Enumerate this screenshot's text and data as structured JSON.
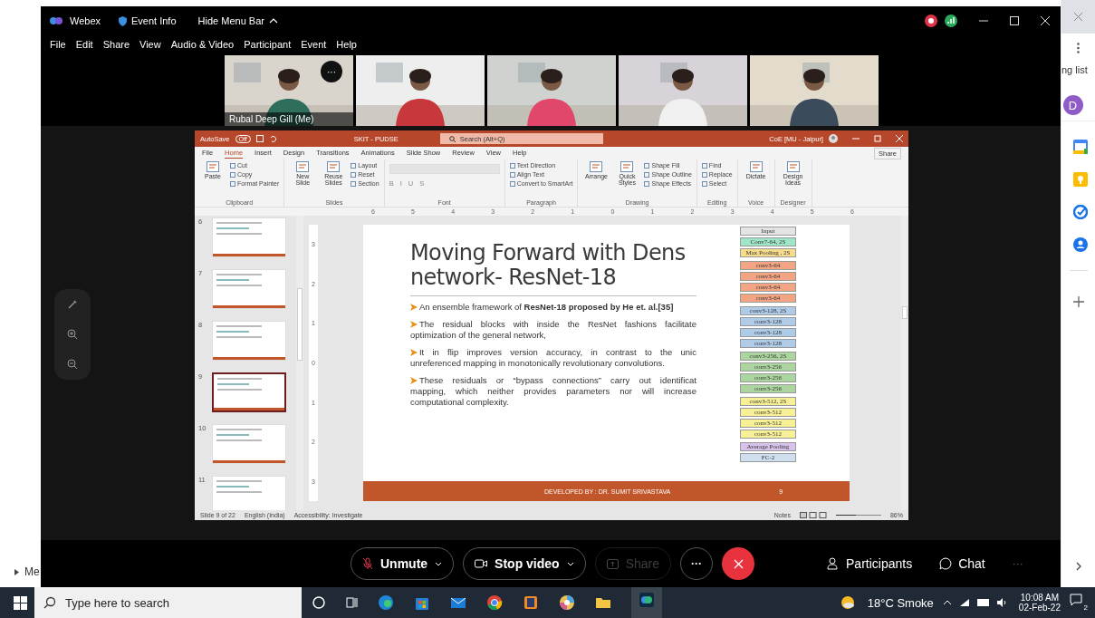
{
  "left_strip": {
    "item": "Me"
  },
  "webex": {
    "title_bar": {
      "app": "Webex",
      "event_info": "Event Info",
      "hide_menu": "Hide Menu Bar"
    },
    "menu": [
      "File",
      "Edit",
      "Share",
      "View",
      "Audio & Video",
      "Participant",
      "Event",
      "Help"
    ],
    "video_tiles": [
      {
        "kind": "picture",
        "label": "Rubal Deep Gill  (Me)",
        "more": "···"
      },
      {
        "kind": "picture"
      },
      {
        "kind": "picture"
      },
      {
        "kind": "picture"
      },
      {
        "kind": "picture"
      }
    ],
    "controls": [
      {
        "kind": "mute",
        "label": "Unmute",
        "disabled": false
      },
      {
        "kind": "video",
        "label": "Stop video",
        "disabled": false
      },
      {
        "kind": "share",
        "label": "Share",
        "disabled": true
      },
      {
        "kind": "more",
        "label": "···",
        "disabled": false
      },
      {
        "kind": "end",
        "disabled": false
      }
    ],
    "side_buttons": [
      {
        "kind": "participants",
        "label": "Participants"
      },
      {
        "kind": "chat",
        "label": "Chat"
      }
    ],
    "overflow": "···"
  },
  "powerpoint": {
    "title_bar": {
      "autosave": "AutoSave",
      "toggle": "Off",
      "file": "SKIT - PUDSE",
      "search": "Search (Alt+Q)",
      "account": "CoE [MU - Jaipur]"
    },
    "tabs": [
      {
        "label": "File",
        "selected": false
      },
      {
        "label": "Home",
        "selected": true
      },
      {
        "label": "Insert",
        "selected": false
      },
      {
        "label": "Design",
        "selected": false
      },
      {
        "label": "Transitions",
        "selected": false
      },
      {
        "label": "Animations",
        "selected": false
      },
      {
        "label": "Slide Show",
        "selected": false
      },
      {
        "label": "Review",
        "selected": false
      },
      {
        "label": "View",
        "selected": false
      },
      {
        "label": "Help",
        "selected": false
      }
    ],
    "share": "Share",
    "ribbon_groups": [
      {
        "name": "Clipboard",
        "items": [
          {
            "label": "Paste",
            "kind": "large"
          },
          {
            "label": "Cut",
            "kind": "small"
          },
          {
            "label": "Copy",
            "kind": "small"
          },
          {
            "label": "Format Painter",
            "kind": "small"
          }
        ]
      },
      {
        "name": "Slides",
        "items": [
          {
            "label": "New Slide",
            "kind": "large"
          },
          {
            "label": "Reuse Slides",
            "kind": "large"
          },
          {
            "label": "Layout",
            "kind": "small"
          },
          {
            "label": "Reset",
            "kind": "small"
          },
          {
            "label": "Section",
            "kind": "small"
          }
        ]
      },
      {
        "name": "Font",
        "items": [
          {
            "label": "B",
            "kind": "glyph"
          },
          {
            "label": "I",
            "kind": "glyph"
          },
          {
            "label": "U",
            "kind": "glyph"
          },
          {
            "label": "S",
            "kind": "glyph"
          }
        ]
      },
      {
        "name": "Paragraph",
        "items": [
          {
            "label": "Text Direction",
            "kind": "small"
          },
          {
            "label": "Align Text",
            "kind": "small"
          },
          {
            "label": "Convert to SmartArt",
            "kind": "small"
          }
        ]
      },
      {
        "name": "Drawing",
        "items": [
          {
            "label": "Arrange",
            "kind": "large"
          },
          {
            "label": "Quick Styles",
            "kind": "large"
          },
          {
            "label": "Shape Fill",
            "kind": "small"
          },
          {
            "label": "Shape Outline",
            "kind": "small"
          },
          {
            "label": "Shape Effects",
            "kind": "small"
          }
        ]
      },
      {
        "name": "Editing",
        "items": [
          {
            "label": "Find",
            "kind": "small"
          },
          {
            "label": "Replace",
            "kind": "small"
          },
          {
            "label": "Select",
            "kind": "small"
          }
        ]
      },
      {
        "name": "Voice",
        "items": [
          {
            "label": "Dictate",
            "kind": "large"
          }
        ]
      },
      {
        "name": "Designer",
        "items": [
          {
            "label": "Design Ideas",
            "kind": "large"
          }
        ]
      }
    ],
    "ruler": [
      "6",
      "5",
      "4",
      "3",
      "2",
      "1",
      "0",
      "1",
      "2",
      "3",
      "4",
      "5",
      "6"
    ],
    "vertical_ruler": [
      "3",
      "2",
      "1",
      "0",
      "1",
      "2",
      "3"
    ],
    "thumbnails": [
      {
        "number": "6",
        "selected": false
      },
      {
        "number": "7",
        "selected": false
      },
      {
        "number": "8",
        "selected": false
      },
      {
        "number": "9",
        "selected": true
      },
      {
        "number": "10",
        "selected": false
      },
      {
        "number": "11",
        "selected": false
      }
    ],
    "slide": {
      "title": [
        "Moving Forward with Dens",
        "network- ResNet-18"
      ],
      "bullets": [
        {
          "lines": [
            "An ensemble framework of **ResNet-18 proposed by He et. al.[35]**"
          ]
        },
        {
          "lines": [
            "The residual blocks with inside the ResNet fashions facilitate",
            "optimization of the general network,"
          ]
        },
        {
          "lines": [
            "It in  flip improves version accuracy, in contrast to the unic",
            "unreferenced mapping in monotonically revolutionary convolutions."
          ]
        },
        {
          "lines": [
            "These residuals or “bypass connections” carry out identificat",
            "mapping, which neither provides parameters nor will increase",
            "computational complexity."
          ]
        }
      ],
      "diagram": [
        {
          "label": "Input",
          "color": "#e4e4e4"
        },
        {
          "label": "Conv7-64, 2S",
          "color": "#9fe6c8"
        },
        {
          "label": "Max Pooling , 2S",
          "color": "#f7dc8c"
        },
        {
          "label": "conv3-64",
          "color": "#f2a483"
        },
        {
          "label": "conv3-64",
          "color": "#f2a483"
        },
        {
          "label": "conv3-64",
          "color": "#f2a483"
        },
        {
          "label": "conv3-64",
          "color": "#f2a483"
        },
        {
          "label": "conv3-128, 2S",
          "color": "#aecbe8"
        },
        {
          "label": "conv3-128",
          "color": "#aecbe8"
        },
        {
          "label": "conv3-128",
          "color": "#aecbe8"
        },
        {
          "label": "conv3-128",
          "color": "#aecbe8"
        },
        {
          "label": "conv3-256, 2S",
          "color": "#acd6a0"
        },
        {
          "label": "conv3-256",
          "color": "#acd6a0"
        },
        {
          "label": "conv3-256",
          "color": "#acd6a0"
        },
        {
          "label": "conv3-256",
          "color": "#acd6a0"
        },
        {
          "label": "conv3-512, 2S",
          "color": "#f8f096"
        },
        {
          "label": "conv3-512",
          "color": "#f8f096"
        },
        {
          "label": "conv3-512",
          "color": "#f8f096"
        },
        {
          "label": "conv3-512",
          "color": "#f8f096"
        },
        {
          "label": "Average Pooling",
          "color": "#d7c2ec"
        },
        {
          "label": "FC-2",
          "color": "#cfdff0"
        }
      ],
      "footer": "DEVELOPED BY : DR. SUMIT SRIVASTAVA",
      "page": "9"
    },
    "status_bar": {
      "slide": "Slide 9 of 22",
      "language": "English (India)",
      "accessibility": "Accessibility: Investigate",
      "notes": "Notes",
      "zoom": {
        "level": 0.45,
        "reading": "86%"
      }
    }
  },
  "side_panel": {
    "label": "ng list",
    "avatar": "D"
  },
  "taskbar": {
    "search": "Type here to search",
    "weather": "18°C  Smoke",
    "time": "10:08 AM",
    "date": "02-Feb-22",
    "notifications": "2"
  }
}
